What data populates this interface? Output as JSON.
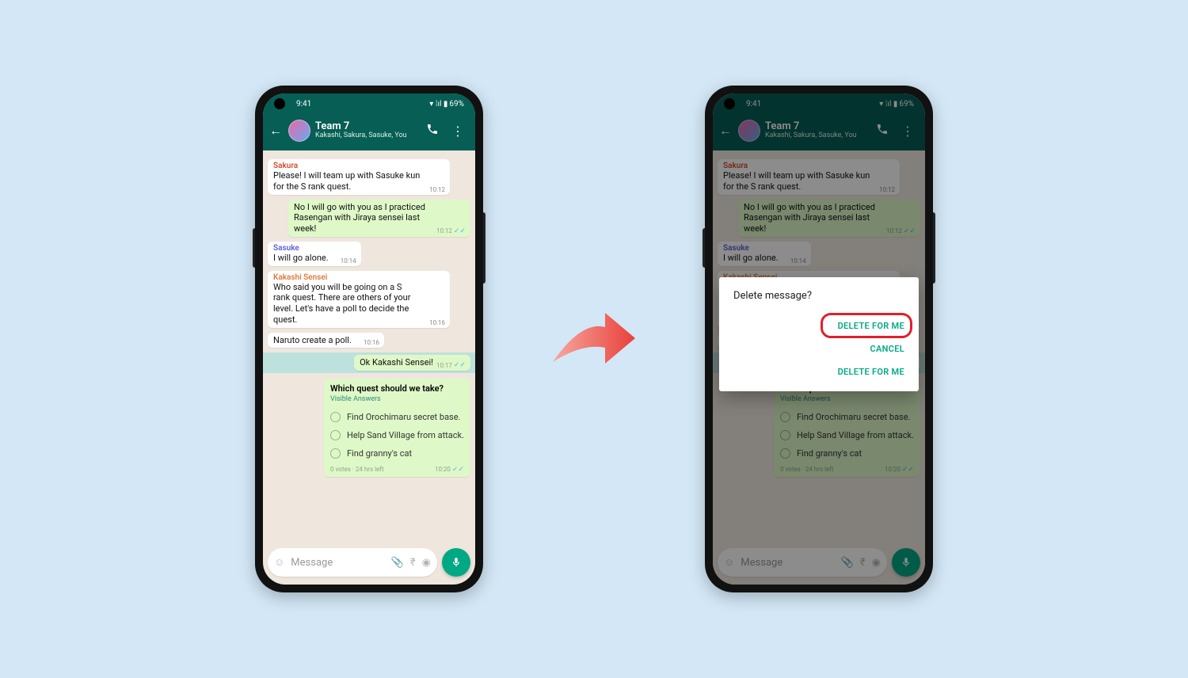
{
  "status": {
    "time": "9:41",
    "battery": "69%",
    "signal": "▾ ⌄ıl ▮"
  },
  "chat": {
    "title": "Team 7",
    "subtitle": "Kakashi, Sakura, Sasuke, You"
  },
  "messages": {
    "m1": {
      "sender": "Sakura",
      "text": "Please! I will team up with Sasuke kun for the S rank quest.",
      "time": "10:12"
    },
    "m2": {
      "text": "No I will go with you as I practiced Rasengan with Jiraya sensei last week!",
      "time": "10:12"
    },
    "m3": {
      "sender": "Sasuke",
      "text": "I will go alone.",
      "time": "10:14"
    },
    "m4": {
      "sender": "Kakashi Sensei",
      "text": "Who said you will be going on a S rank quest. There are others of your level. Let's have a poll to decide the quest.",
      "time": "10:16"
    },
    "m5": {
      "text": "Naruto create a poll.",
      "time": "10:16"
    },
    "m6": {
      "text": "Ok Kakashi Sensei!",
      "time": "10:17"
    }
  },
  "poll": {
    "question": "Which quest should we take?",
    "visible": "Visible Answers",
    "opts": [
      "Find Orochimaru secret base.",
      "Help Sand Village from attack.",
      "Find granny's cat"
    ],
    "footer_left": "0 votes · 24 hrs left",
    "time": "10:20"
  },
  "input": {
    "placeholder": "Message"
  },
  "dialog": {
    "title": "Delete message?",
    "btn1": "DELETE FOR ME",
    "btn2": "CANCEL",
    "btn3": "DELETE FOR ME"
  }
}
